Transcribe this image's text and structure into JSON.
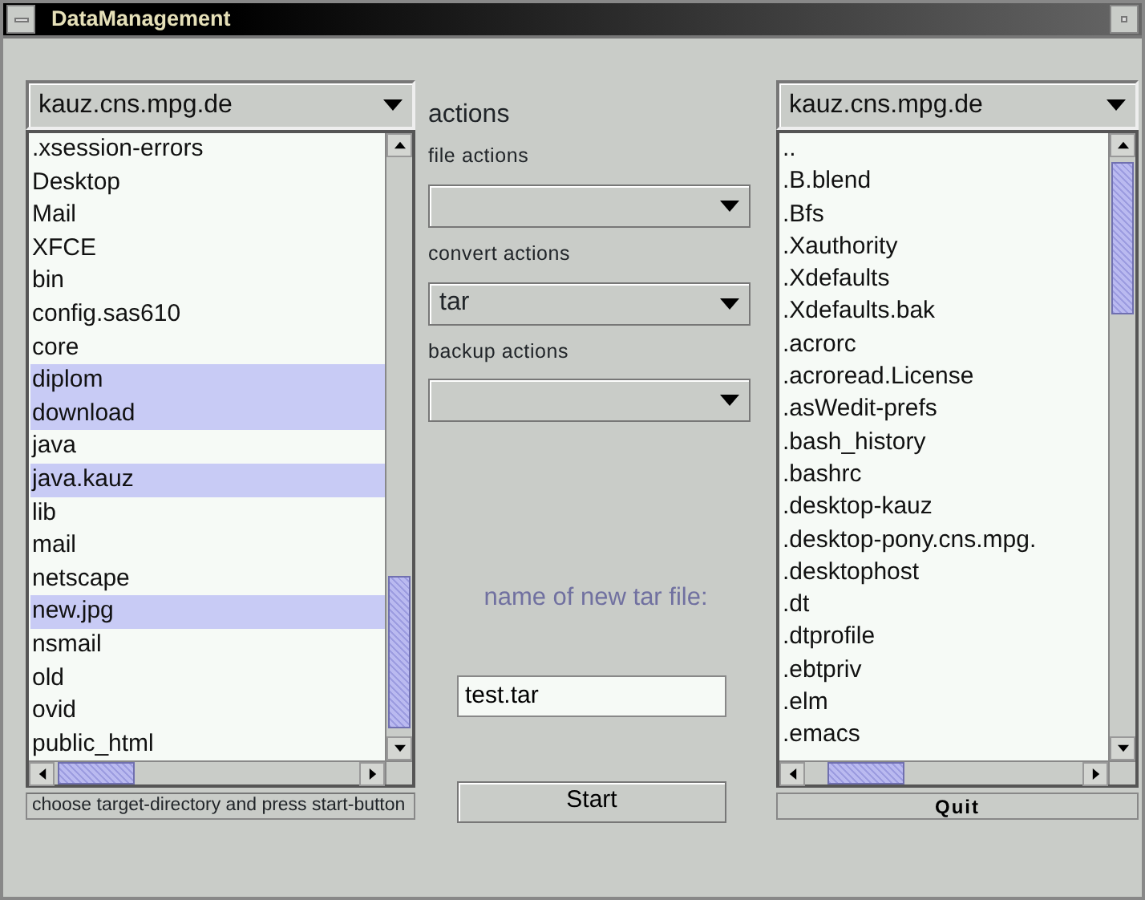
{
  "window": {
    "title": "DataManagement"
  },
  "left_panel": {
    "host": "kauz.cns.mpg.de",
    "files": [
      {
        "name": ".xsession-errors",
        "selected": false
      },
      {
        "name": "Desktop",
        "selected": false
      },
      {
        "name": "Mail",
        "selected": false
      },
      {
        "name": "XFCE",
        "selected": false
      },
      {
        "name": "bin",
        "selected": false
      },
      {
        "name": "config.sas610",
        "selected": false
      },
      {
        "name": "core",
        "selected": false
      },
      {
        "name": "diplom",
        "selected": true
      },
      {
        "name": "download",
        "selected": true
      },
      {
        "name": "java",
        "selected": false
      },
      {
        "name": "java.kauz",
        "selected": true
      },
      {
        "name": "lib",
        "selected": false
      },
      {
        "name": "mail",
        "selected": false
      },
      {
        "name": "netscape",
        "selected": false
      },
      {
        "name": "new.jpg",
        "selected": true
      },
      {
        "name": "nsmail",
        "selected": false
      },
      {
        "name": "old",
        "selected": false
      },
      {
        "name": "ovid",
        "selected": false
      },
      {
        "name": "public_html",
        "selected": false
      }
    ]
  },
  "actions": {
    "title": "actions",
    "groups": [
      {
        "label": "file actions"
      },
      {
        "label": "convert actions",
        "value": "tar"
      },
      {
        "label": "backup actions"
      }
    ]
  },
  "tar_name": {
    "label": "name of new tar file:",
    "value": "test.tar"
  },
  "start_button": "Start",
  "right_panel": {
    "host": "kauz.cns.mpg.de",
    "files": [
      {
        "name": "..",
        "selected": false
      },
      {
        "name": ".B.blend",
        "selected": false
      },
      {
        "name": ".Bfs",
        "selected": false
      },
      {
        "name": ".Xauthority",
        "selected": false
      },
      {
        "name": ".Xdefaults",
        "selected": false
      },
      {
        "name": ".Xdefaults.bak",
        "selected": false
      },
      {
        "name": ".acrorc",
        "selected": false
      },
      {
        "name": ".acroread.License",
        "selected": false
      },
      {
        "name": ".asWedit-prefs",
        "selected": false
      },
      {
        "name": ".bash_history",
        "selected": false
      },
      {
        "name": ".bashrc",
        "selected": false
      },
      {
        "name": ".desktop-kauz",
        "selected": false
      },
      {
        "name": ".desktop-pony.cns.mpg.",
        "selected": false
      },
      {
        "name": ".desktophost",
        "selected": false
      },
      {
        "name": ".dt",
        "selected": false
      },
      {
        "name": ".dtprofile",
        "selected": false
      },
      {
        "name": ".ebtpriv",
        "selected": false
      },
      {
        "name": ".elm",
        "selected": false
      },
      {
        "name": ".emacs",
        "selected": false
      }
    ]
  },
  "status_bar": "choose target-directory and press start-button",
  "quit_button": "Quit"
}
